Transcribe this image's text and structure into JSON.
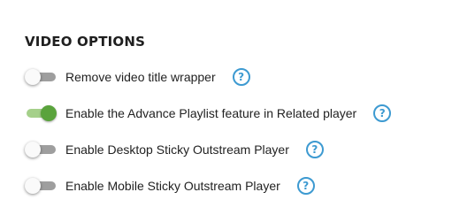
{
  "section": {
    "title": "VIDEO OPTIONS"
  },
  "options": [
    {
      "label": "Remove video title wrapper",
      "enabled": false,
      "help_icon": "question-circle-icon",
      "help_glyph": "?"
    },
    {
      "label": "Enable the Advance Playlist feature in Related player",
      "enabled": true,
      "help_icon": "question-circle-icon",
      "help_glyph": "?"
    },
    {
      "label": "Enable Desktop Sticky Outstream Player",
      "enabled": false,
      "help_icon": "question-circle-icon",
      "help_glyph": "?"
    },
    {
      "label": "Enable Mobile Sticky Outstream Player",
      "enabled": false,
      "help_icon": "question-circle-icon",
      "help_glyph": "?"
    }
  ],
  "colors": {
    "toggle_on_track": "#a5d08a",
    "toggle_on_knob": "#5aa33c",
    "toggle_off_track": "#9e9e9e",
    "help_icon": "#3d9ad1"
  }
}
